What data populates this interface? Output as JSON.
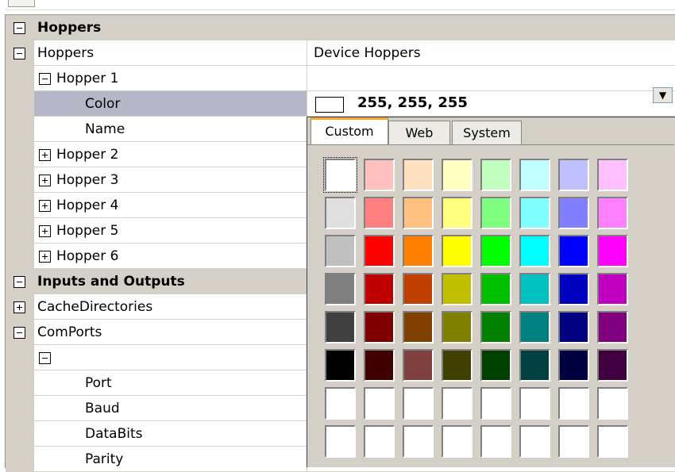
{
  "rows": [
    {
      "type": "category",
      "label": "Hoppers"
    },
    {
      "type": "group",
      "label": "Hoppers",
      "value": "Device Hoppers"
    },
    {
      "type": "sub",
      "label": "Hopper 1"
    },
    {
      "type": "prop",
      "label": "Color"
    },
    {
      "type": "prop",
      "label": "Name"
    },
    {
      "type": "subc",
      "label": "Hopper 2"
    },
    {
      "type": "subc",
      "label": "Hopper 3"
    },
    {
      "type": "subc",
      "label": "Hopper 4"
    },
    {
      "type": "subc",
      "label": "Hopper 5"
    },
    {
      "type": "subc",
      "label": "Hopper 6"
    },
    {
      "type": "category",
      "label": "Inputs and Outputs"
    },
    {
      "type": "groupc",
      "label": "CacheDirectories"
    },
    {
      "type": "group",
      "label": "ComPorts"
    },
    {
      "type": "sub",
      "label": ""
    },
    {
      "type": "prop",
      "label": "Port"
    },
    {
      "type": "prop",
      "label": "Baud"
    },
    {
      "type": "prop",
      "label": "DataBits"
    },
    {
      "type": "prop",
      "label": "Parity"
    }
  ],
  "color_value": "255, 255, 255",
  "tabs": [
    "Custom",
    "Web",
    "System"
  ],
  "palette": [
    [
      "#ffffff",
      "#ffc0c0",
      "#ffe0c0",
      "#ffffc0",
      "#c0ffc0",
      "#c0ffff",
      "#c0c0ff",
      "#ffc0ff"
    ],
    [
      "#e0e0e0",
      "#ff8080",
      "#ffc080",
      "#ffff80",
      "#80ff80",
      "#80ffff",
      "#8080ff",
      "#ff80ff"
    ],
    [
      "#c0c0c0",
      "#ff0000",
      "#ff8000",
      "#ffff00",
      "#00ff00",
      "#00ffff",
      "#0000ff",
      "#ff00ff"
    ],
    [
      "#808080",
      "#c00000",
      "#c04000",
      "#c0c000",
      "#00c000",
      "#00c0c0",
      "#0000c0",
      "#c000c0"
    ],
    [
      "#404040",
      "#800000",
      "#804000",
      "#808000",
      "#008000",
      "#008080",
      "#000080",
      "#800080"
    ],
    [
      "#000000",
      "#400000",
      "#804040",
      "#404000",
      "#004000",
      "#004040",
      "#000040",
      "#400040"
    ],
    [
      "#ffffff",
      "#ffffff",
      "#ffffff",
      "#ffffff",
      "#ffffff",
      "#ffffff",
      "#ffffff",
      "#ffffff"
    ],
    [
      "#ffffff",
      "#ffffff",
      "#ffffff",
      "#ffffff",
      "#ffffff",
      "#ffffff",
      "#ffffff",
      "#ffffff"
    ]
  ]
}
